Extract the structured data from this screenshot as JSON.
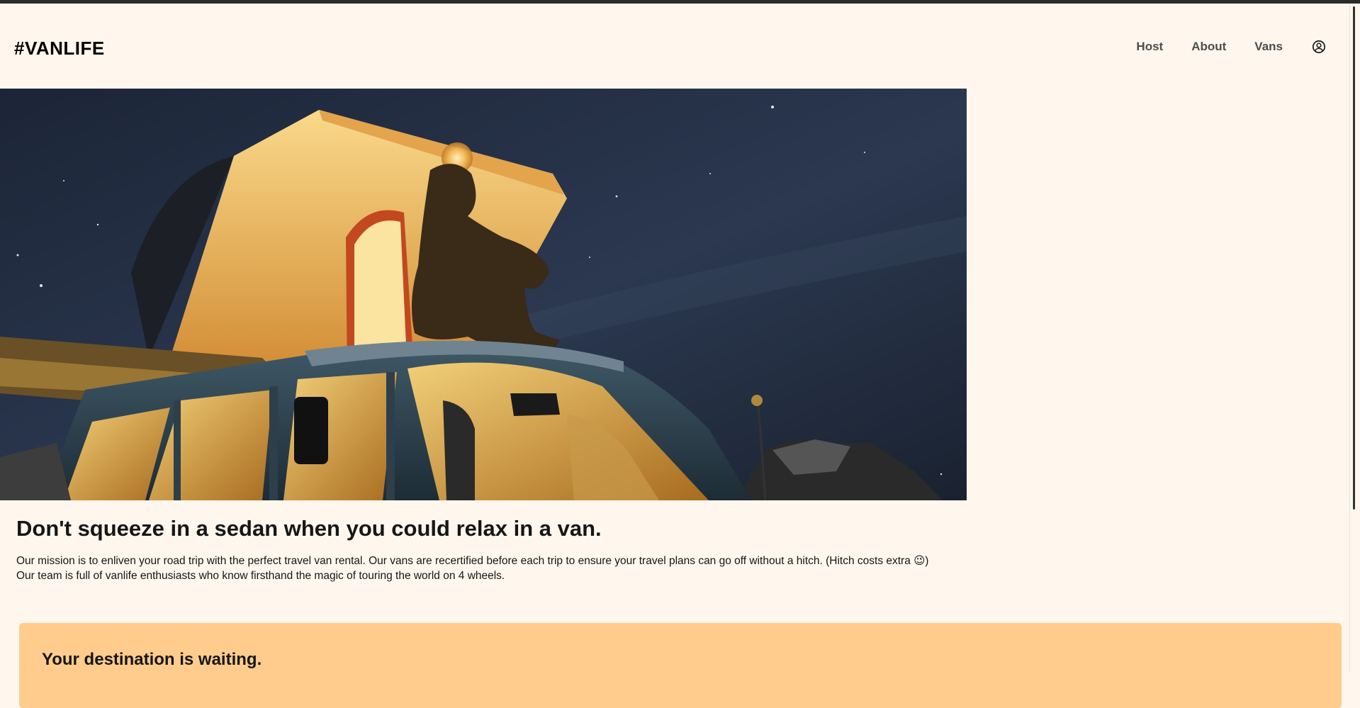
{
  "header": {
    "logo": "#VANLIFE",
    "nav": [
      {
        "label": "Host"
      },
      {
        "label": "About"
      },
      {
        "label": "Vans"
      }
    ],
    "profile_icon": "user-circle-icon"
  },
  "hero": {
    "image": "van-night-photo",
    "subject": "person sitting on roof of lit pop-up camper van under starry night sky"
  },
  "about": {
    "title": "Don't squeeze in a sedan when you could relax in a van.",
    "paragraph_1": "Our mission is to enliven your road trip with the perfect travel van rental. Our vans are recertified before each trip to ensure your travel plans can go off without a hitch. (Hitch costs extra 😉)",
    "paragraph_2": "Our team is full of vanlife enthusiasts who know firsthand the magic of touring the world on 4 wheels."
  },
  "cta": {
    "title": "Your destination is waiting."
  },
  "colors": {
    "background": "#FFF7ED",
    "cta_background": "#FFCC8D",
    "text": "#161616",
    "nav_text": "#4D4D4D"
  }
}
